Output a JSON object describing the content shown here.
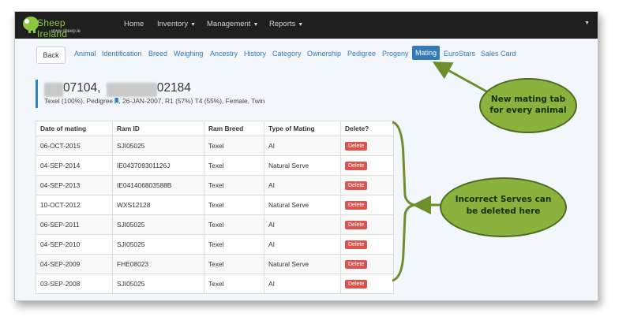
{
  "brand": {
    "name": "Sheep Ireland",
    "sub": "www.sheep.ie"
  },
  "nav": {
    "items": [
      {
        "label": "Home"
      },
      {
        "label": "Inventory"
      },
      {
        "label": "Management"
      },
      {
        "label": "Reports"
      }
    ]
  },
  "back_label": "Back",
  "tabs": [
    "Animal",
    "Identification",
    "Breed",
    "Weighing",
    "Ancestry",
    "History",
    "Category",
    "Ownership",
    "Pedigree",
    "Progeny",
    "Mating",
    "EuroStars",
    "Sales Card"
  ],
  "active_tab": "Mating",
  "animal": {
    "id_visible_1": "07104,",
    "id_visible_2": "02184",
    "info_pre": "Texel (100%), Pedigree",
    "info_post": ", 26-JAN-2007, R1 (57%) T4 (55%), Female, Twin"
  },
  "table": {
    "headers": [
      "Date of mating",
      "Ram ID",
      "Ram Breed",
      "Type of Mating",
      "Delete?"
    ],
    "delete_label": "Delete",
    "rows": [
      {
        "date": "06-OCT-2015",
        "ram_id": "SJI05025",
        "breed": "Texel",
        "type": "AI"
      },
      {
        "date": "04-SEP-2014",
        "ram_id": "IE043709301126J",
        "breed": "Texel",
        "type": "Natural Serve"
      },
      {
        "date": "04-SEP-2013",
        "ram_id": "IE041406803588B",
        "breed": "Texel",
        "type": "AI"
      },
      {
        "date": "10-OCT-2012",
        "ram_id": "WXS12128",
        "breed": "Texel",
        "type": "Natural Serve"
      },
      {
        "date": "06-SEP-2011",
        "ram_id": "SJI05025",
        "breed": "Texel",
        "type": "AI"
      },
      {
        "date": "04-SEP-2010",
        "ram_id": "SJI05025",
        "breed": "Texel",
        "type": "AI"
      },
      {
        "date": "04-SEP-2009",
        "ram_id": "FHE08023",
        "breed": "Texel",
        "type": "Natural Serve"
      },
      {
        "date": "03-SEP-2008",
        "ram_id": "SJI05025",
        "breed": "Texel",
        "type": "AI"
      }
    ]
  },
  "annotations": {
    "mating_tab": [
      "New mating tab",
      "for every animal"
    ],
    "delete": [
      "Incorrect Serves can",
      "be deleted here"
    ]
  },
  "colors": {
    "navbar": "#1f1f1f",
    "link": "#337ab7",
    "active_tab": "#337ab7",
    "delete_button": "#d9534f",
    "callout_fill": "#8ab33d",
    "callout_stroke": "#4e6b24"
  },
  "icons": [
    "sheep-logo-icon",
    "pedigree-bookmark-icon",
    "caret-down-icon"
  ]
}
